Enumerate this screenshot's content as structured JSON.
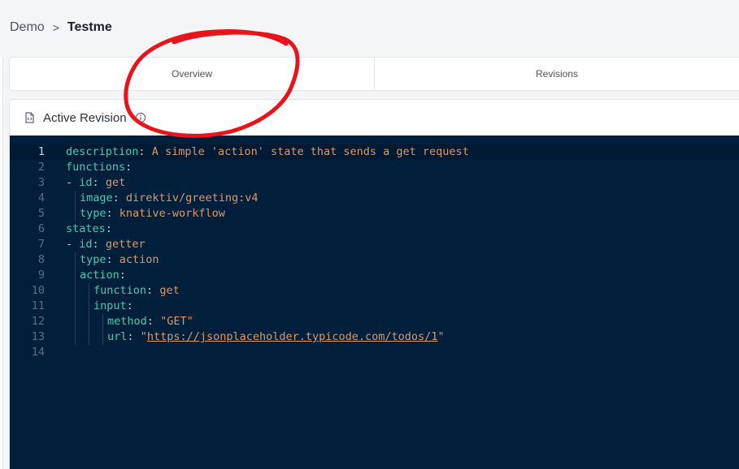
{
  "breadcrumb": {
    "items": [
      "Demo"
    ],
    "separator": ">",
    "current": "Testme"
  },
  "tabs": [
    {
      "label": "Overview"
    },
    {
      "label": "Revisions"
    }
  ],
  "card": {
    "title": "Active Revision",
    "title_icon": "file-code-icon",
    "info_icon": "info-icon"
  },
  "editor": {
    "active_line": 1,
    "lines": [
      {
        "num": "1",
        "key": "description",
        "value": "A simple 'action' state that sends a get request"
      },
      {
        "num": "2",
        "key": "functions",
        "value": ""
      },
      {
        "num": "3",
        "dash": "- ",
        "key": "id",
        "value": "get"
      },
      {
        "num": "4",
        "key": "image",
        "value": "direktiv/greeting:v4"
      },
      {
        "num": "5",
        "key": "type",
        "value": "knative-workflow"
      },
      {
        "num": "6",
        "key": "states",
        "value": ""
      },
      {
        "num": "7",
        "dash": "- ",
        "key": "id",
        "value": "getter"
      },
      {
        "num": "8",
        "key": "type",
        "value": "action"
      },
      {
        "num": "9",
        "key": "action",
        "value": ""
      },
      {
        "num": "10",
        "key": "function",
        "value": "get"
      },
      {
        "num": "11",
        "key": "input",
        "value": ""
      },
      {
        "num": "12",
        "key": "method",
        "value": "\"GET\""
      },
      {
        "num": "13",
        "key": "url",
        "quote": "\"",
        "url": "https://jsonplaceholder.typicode.com/todos/1"
      },
      {
        "num": "14"
      }
    ]
  },
  "colors": {
    "editor_bg": "#001f3b",
    "key": "#4ec9b0",
    "value": "#d89a6e",
    "annotation": "#e8141b"
  }
}
